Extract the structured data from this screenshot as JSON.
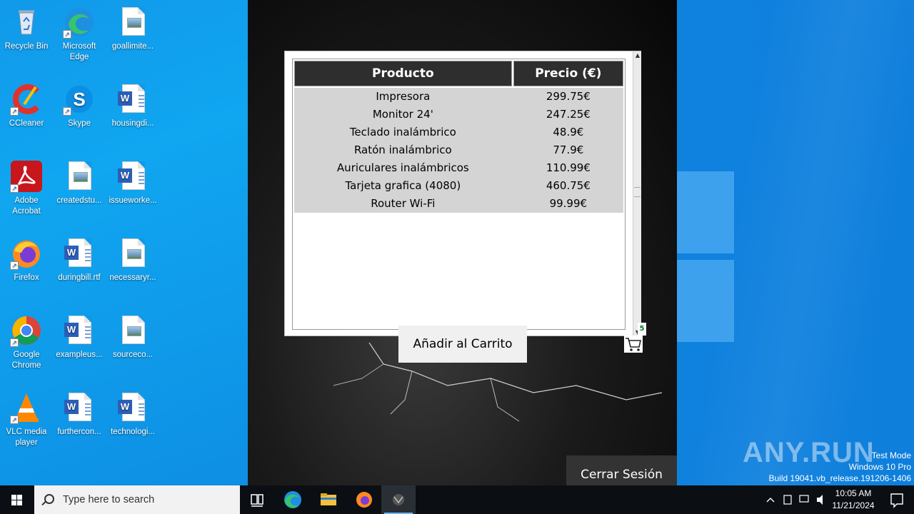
{
  "desktop": {
    "icons": [
      {
        "name": "recycle-bin",
        "label": "Recycle Bin",
        "icon": "recycle-bin-icon"
      },
      {
        "name": "edge",
        "label": "Microsoft Edge",
        "icon": "edge-icon"
      },
      {
        "name": "goallimite",
        "label": "goallimite...",
        "icon": "image-file-icon"
      },
      {
        "name": "ccleaner",
        "label": "CCleaner",
        "icon": "ccleaner-icon"
      },
      {
        "name": "skype",
        "label": "Skype",
        "icon": "skype-icon"
      },
      {
        "name": "housingdi",
        "label": "housingdi...",
        "icon": "word-doc-icon"
      },
      {
        "name": "acrobat",
        "label": "Adobe Acrobat",
        "icon": "acrobat-icon"
      },
      {
        "name": "createdstu",
        "label": "createdstu...",
        "icon": "image-file-icon"
      },
      {
        "name": "issueworke",
        "label": "issueworke...",
        "icon": "word-doc-icon"
      },
      {
        "name": "firefox",
        "label": "Firefox",
        "icon": "firefox-icon"
      },
      {
        "name": "duringbill",
        "label": "duringbill.rtf",
        "icon": "word-doc-icon"
      },
      {
        "name": "necessaryr",
        "label": "necessaryr...",
        "icon": "image-file-icon"
      },
      {
        "name": "chrome",
        "label": "Google Chrome",
        "icon": "chrome-icon"
      },
      {
        "name": "exampleus",
        "label": "exampleus...",
        "icon": "word-doc-icon"
      },
      {
        "name": "sourceco",
        "label": "sourceco...",
        "icon": "image-file-icon"
      },
      {
        "name": "vlc",
        "label": "VLC media player",
        "icon": "vlc-icon"
      },
      {
        "name": "furthercon",
        "label": "furthercon...",
        "icon": "word-doc-icon"
      },
      {
        "name": "technologi",
        "label": "technologi...",
        "icon": "word-doc-icon"
      }
    ]
  },
  "app": {
    "table": {
      "headers": [
        "Producto",
        "Precio (€)"
      ],
      "rows": [
        {
          "product": "Impresora",
          "price": "299.75€"
        },
        {
          "product": "Monitor 24'",
          "price": "247.25€"
        },
        {
          "product": "Teclado inalámbrico",
          "price": "48.9€"
        },
        {
          "product": "Ratón inalámbrico",
          "price": "77.9€"
        },
        {
          "product": "Auriculares inalámbricos",
          "price": "110.99€"
        },
        {
          "product": "Tarjeta grafica (4080)",
          "price": "460.75€"
        },
        {
          "product": "Router Wi-Fi",
          "price": "99.99€"
        }
      ]
    },
    "add_to_cart_label": "Añadir al Carrito",
    "cart_count": "5",
    "logout_label": "Cerrar Sesión"
  },
  "watermark": {
    "logo": "ANY.RUN",
    "line1": "Test Mode",
    "line2": "Windows 10 Pro",
    "line3": "Build 19041.vb_release.191206-1406"
  },
  "taskbar": {
    "search_placeholder": "Type here to search",
    "time": "10:05 AM",
    "date": "11/21/2024"
  },
  "colors": {
    "desktop_blue": "#0f86e3",
    "table_header_bg": "#2e2e2e",
    "table_rows_bg": "#d4d4d4",
    "cart_badge": "#0a7a2a"
  }
}
